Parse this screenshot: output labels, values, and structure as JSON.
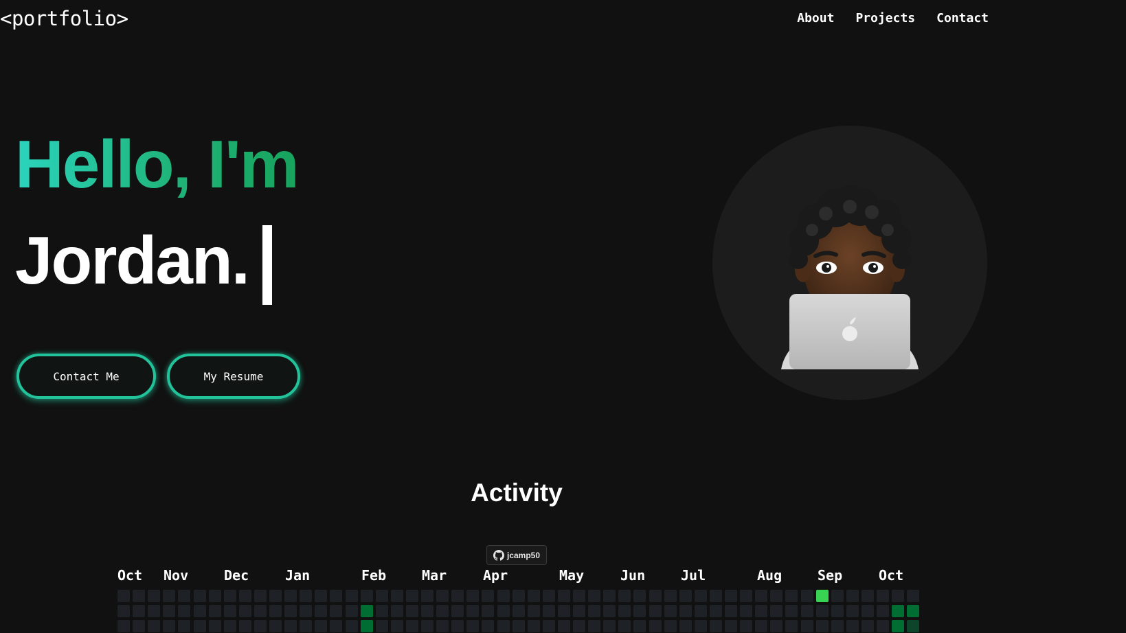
{
  "header": {
    "logo": "<portfolio>",
    "nav": [
      {
        "label": "About"
      },
      {
        "label": "Projects"
      },
      {
        "label": "Contact"
      }
    ]
  },
  "hero": {
    "greeting": "Hello, I'm",
    "name": "Jordan.",
    "accent_gradient": [
      "#2bd4bd",
      "#17a35c"
    ],
    "buttons": {
      "contact_label": "Contact Me",
      "resume_label": "My Resume"
    },
    "button_border_color": "#22c39a"
  },
  "activity": {
    "title": "Activity",
    "github_username": "jcamp50",
    "months": [
      "Oct",
      "Nov",
      "Dec",
      "Jan",
      "Feb",
      "Mar",
      "Apr",
      "May",
      "Jun",
      "Jul",
      "Aug",
      "Sep",
      "Oct"
    ],
    "level_colors": [
      "#1e2226",
      "#0e4429",
      "#006d32",
      "#26a641",
      "#39d353"
    ],
    "weeks": 53,
    "highlighted_cells": [
      {
        "week": 16,
        "day": 1,
        "level": 2
      },
      {
        "week": 16,
        "day": 2,
        "level": 2
      },
      {
        "week": 46,
        "day": 0,
        "level": 4
      },
      {
        "week": 51,
        "day": 1,
        "level": 2
      },
      {
        "week": 51,
        "day": 2,
        "level": 2
      },
      {
        "week": 52,
        "day": 1,
        "level": 2
      },
      {
        "week": 52,
        "day": 2,
        "level": 1
      }
    ]
  }
}
